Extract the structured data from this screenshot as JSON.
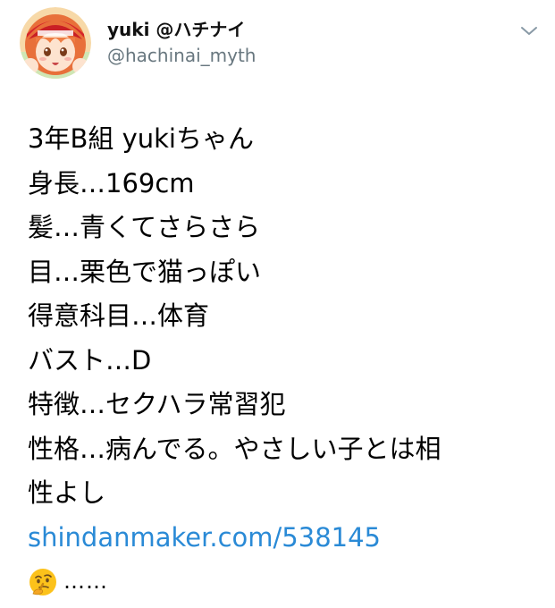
{
  "user": {
    "display_name": "yuki @ハチナイ",
    "handle": "@hachinai_myth",
    "avatar_icon": "anime-avatar-icon"
  },
  "header": {
    "more_icon": "chevron-down-icon"
  },
  "tweet": {
    "lines": [
      "3年B組 yukiちゃん",
      "身長…169cm",
      "髪…青くてさらさら",
      "目…栗色で猫っぽい",
      "得意科目…体育",
      "バスト…D",
      "特徴…セクハラ常習犯",
      "性格…病んでる。やさしい子とは相",
      "性よし"
    ],
    "link": "shindanmaker.com/538145",
    "emoji_icon": "thinking-face-emoji",
    "trailing_text": "……"
  },
  "colors": {
    "link": "#2a8ad6",
    "handle": "#68777f",
    "text": "#000000"
  }
}
